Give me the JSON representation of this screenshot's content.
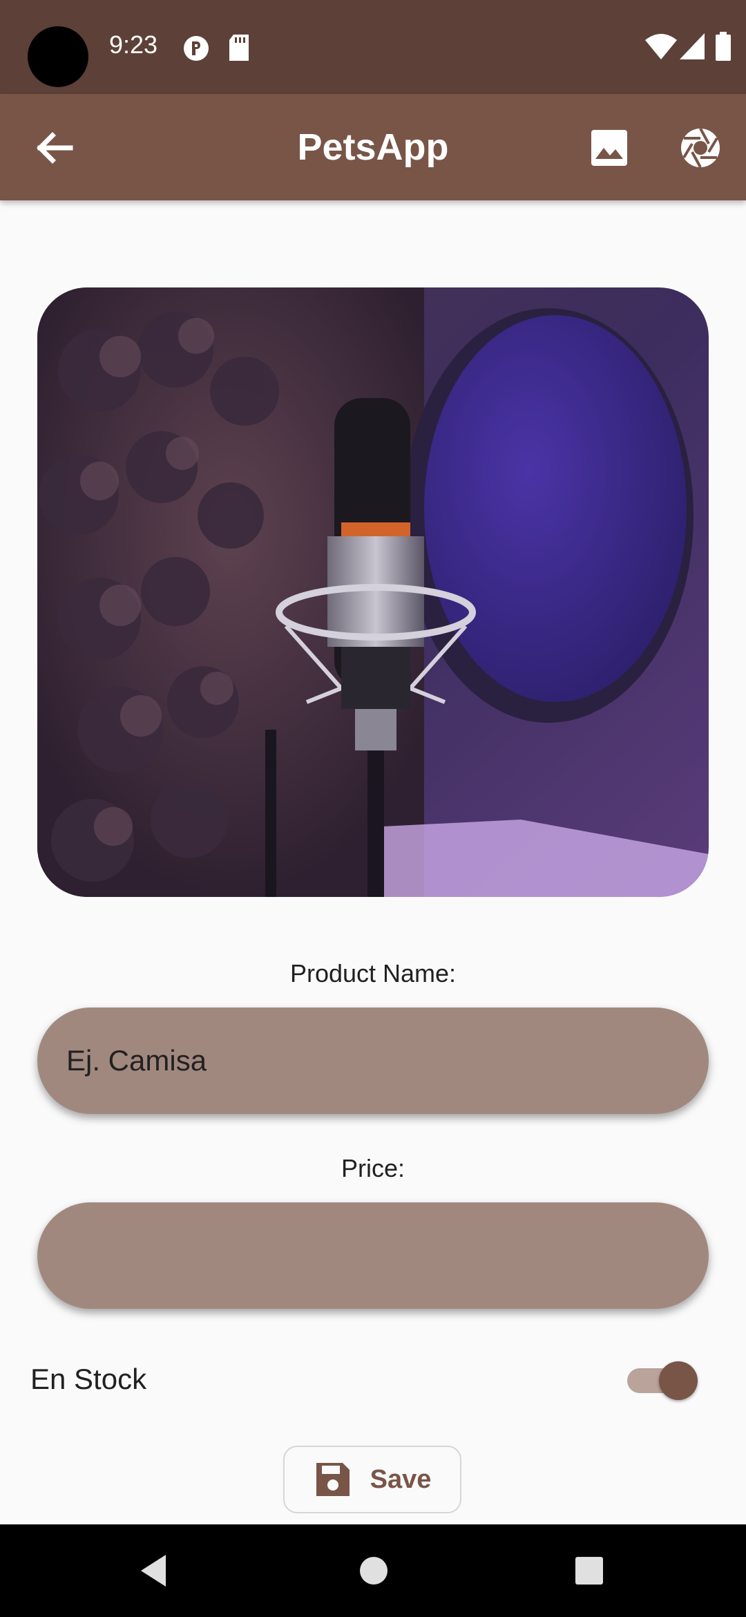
{
  "status_bar": {
    "time": "9:23",
    "icons": [
      "camera-hole",
      "notification-p-icon",
      "sd-card-icon",
      "wifi-icon",
      "signal-icon",
      "battery-icon"
    ]
  },
  "app_bar": {
    "title": "PetsApp",
    "back_icon": "arrow-back-icon",
    "gallery_icon": "image-icon",
    "camera_icon": "camera-shutter-icon",
    "color": "#795548"
  },
  "product_image": {
    "icon": "product-photo"
  },
  "form": {
    "name_label": "Product Name:",
    "name_placeholder": "Ej. Camisa",
    "name_value": "",
    "price_label": "Price:",
    "price_placeholder": "",
    "price_value": "",
    "stock_label": "En Stock",
    "stock_enabled": true,
    "field_color": "#a1887f"
  },
  "save_button": {
    "label": "Save",
    "icon": "save-icon"
  },
  "nav_bar": {
    "back_icon": "nav-back-icon",
    "home_icon": "nav-home-icon",
    "recents_icon": "nav-recents-icon"
  }
}
